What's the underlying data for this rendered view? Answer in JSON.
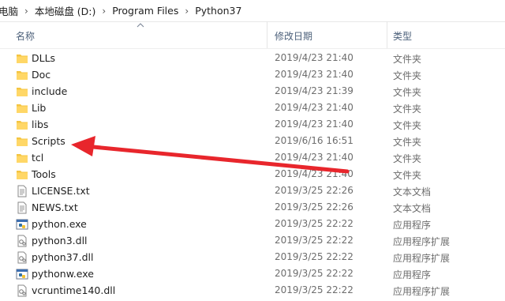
{
  "breadcrumb": {
    "items": [
      "电脑",
      "本地磁盘 (D:)",
      "Program Files",
      "Python37"
    ],
    "separator": "›"
  },
  "columns": {
    "name": "名称",
    "modified": "修改日期",
    "type": "类型"
  },
  "files": [
    {
      "name": "DLLs",
      "modified": "2019/4/23 21:40",
      "type": "文件夹",
      "icon": "folder-icon"
    },
    {
      "name": "Doc",
      "modified": "2019/4/23 21:40",
      "type": "文件夹",
      "icon": "folder-icon"
    },
    {
      "name": "include",
      "modified": "2019/4/23 21:39",
      "type": "文件夹",
      "icon": "folder-icon"
    },
    {
      "name": "Lib",
      "modified": "2019/4/23 21:40",
      "type": "文件夹",
      "icon": "folder-icon"
    },
    {
      "name": "libs",
      "modified": "2019/4/23 21:40",
      "type": "文件夹",
      "icon": "folder-icon"
    },
    {
      "name": "Scripts",
      "modified": "2019/6/16 16:51",
      "type": "文件夹",
      "icon": "folder-icon"
    },
    {
      "name": "tcl",
      "modified": "2019/4/23 21:40",
      "type": "文件夹",
      "icon": "folder-icon"
    },
    {
      "name": "Tools",
      "modified": "2019/4/23 21:40",
      "type": "文件夹",
      "icon": "folder-icon"
    },
    {
      "name": "LICENSE.txt",
      "modified": "2019/3/25 22:26",
      "type": "文本文档",
      "icon": "text-file-icon"
    },
    {
      "name": "NEWS.txt",
      "modified": "2019/3/25 22:26",
      "type": "文本文档",
      "icon": "text-file-icon"
    },
    {
      "name": "python.exe",
      "modified": "2019/3/25 22:22",
      "type": "应用程序",
      "icon": "python-exe-icon"
    },
    {
      "name": "python3.dll",
      "modified": "2019/3/25 22:22",
      "type": "应用程序扩展",
      "icon": "dll-file-icon"
    },
    {
      "name": "python37.dll",
      "modified": "2019/3/25 22:22",
      "type": "应用程序扩展",
      "icon": "dll-file-icon"
    },
    {
      "name": "pythonw.exe",
      "modified": "2019/3/25 22:22",
      "type": "应用程序",
      "icon": "python-exe-icon"
    },
    {
      "name": "vcruntime140.dll",
      "modified": "2019/3/25 22:22",
      "type": "应用程序扩展",
      "icon": "dll-file-icon"
    }
  ],
  "annotation": {
    "color": "#e8262c",
    "points_to": "Scripts"
  }
}
